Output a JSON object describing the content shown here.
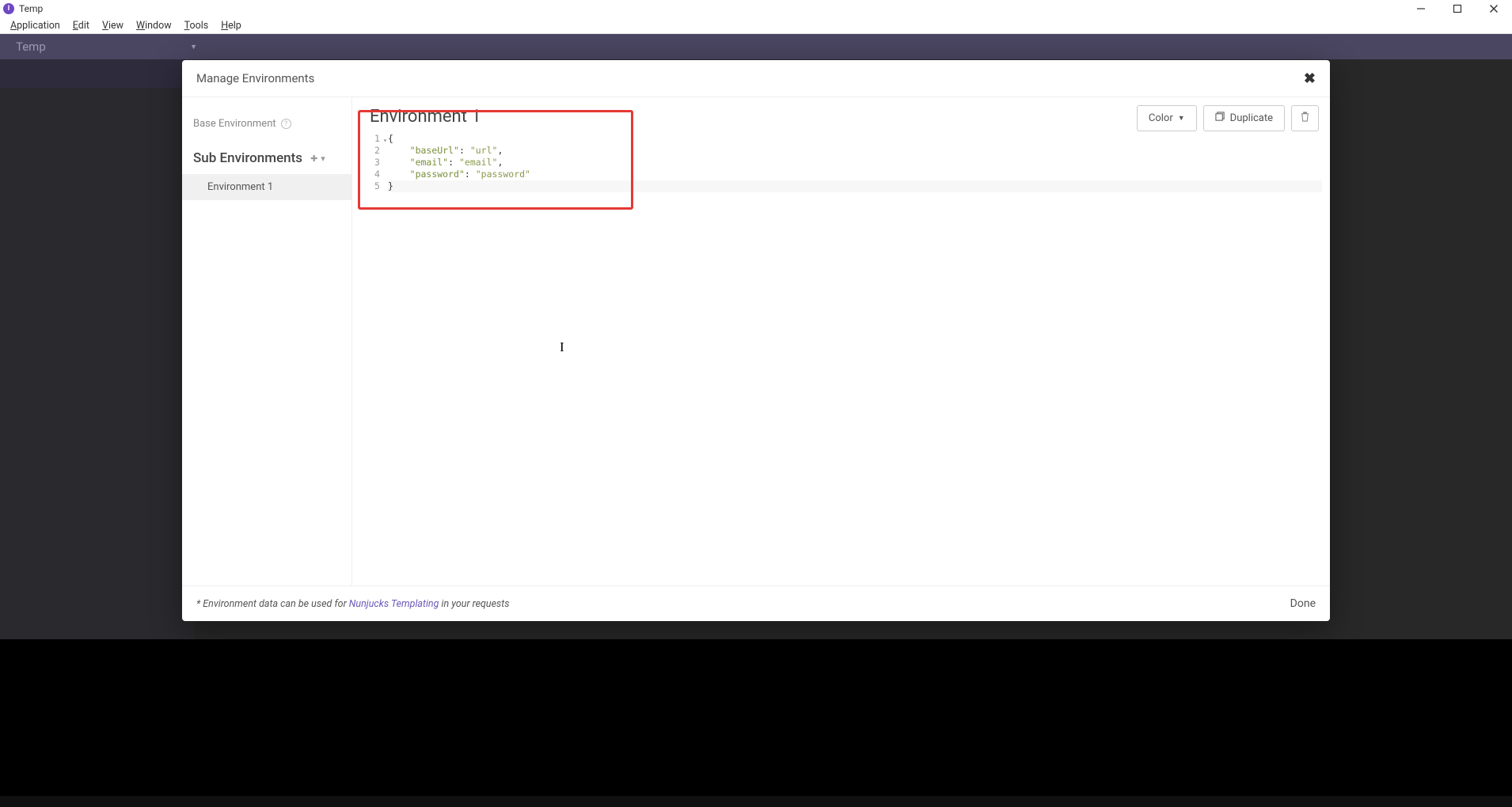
{
  "window": {
    "title": "Temp"
  },
  "menubar": {
    "application": "Application",
    "edit": "Edit",
    "view": "View",
    "window": "Window",
    "tools": "Tools",
    "help": "Help"
  },
  "bg": {
    "workspace": "Temp"
  },
  "modal": {
    "title": "Manage Environments",
    "base_env_label": "Base Environment",
    "sub_env_label": "Sub Environments",
    "env_list": [
      "Environment 1"
    ],
    "selected_env_name": "Environment 1",
    "toolbar": {
      "color": "Color",
      "duplicate": "Duplicate"
    },
    "code": {
      "line_numbers": [
        "1",
        "2",
        "3",
        "4",
        "5"
      ],
      "json_body": {
        "baseUrl": "url",
        "email": "email",
        "password": "password"
      }
    },
    "footer": {
      "prefix": "* Environment data can be used for ",
      "link": "Nunjucks Templating",
      "suffix": " in your requests",
      "done": "Done"
    }
  }
}
